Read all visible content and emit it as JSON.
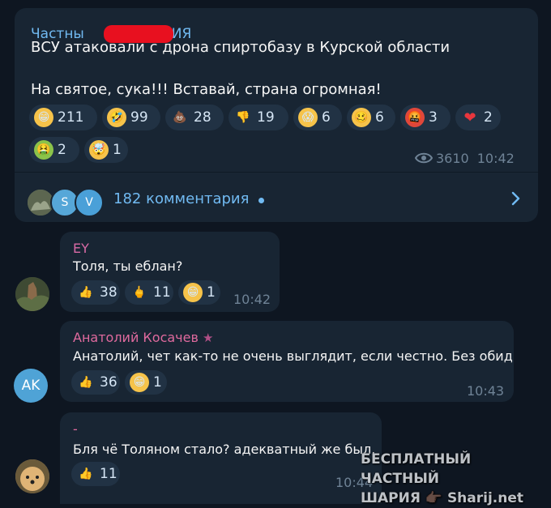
{
  "post": {
    "channel_visible": "Частны",
    "channel_tail": "АРИЯ",
    "line1": "ВСУ атаковали с дрона спиртобазу в Курской области",
    "line2": "На святое, сука!!! Вставай, страна огромная!",
    "reactions": [
      {
        "emoji": "😁",
        "count": "211",
        "icon": "grin-emoji",
        "bg": "#f6c34a"
      },
      {
        "emoji": "🤣",
        "count": "99",
        "icon": "rofl-emoji",
        "bg": "#f6c34a"
      },
      {
        "emoji": "💩",
        "count": "28",
        "icon": "poop-emoji",
        "bg": "transparent"
      },
      {
        "emoji": "👎",
        "count": "19",
        "icon": "thumbs-down-emoji",
        "bg": "transparent"
      },
      {
        "emoji": "😱",
        "count": "6",
        "icon": "scream-emoji",
        "bg": "#f6c34a"
      },
      {
        "emoji": "🥴",
        "count": "6",
        "icon": "woozy-emoji",
        "bg": "#f6c34a"
      },
      {
        "emoji": "🤬",
        "count": "3",
        "icon": "cursing-emoji",
        "bg": "#e0473a"
      },
      {
        "emoji": "❤",
        "count": "2",
        "icon": "heart-emoji",
        "bg": "transparent"
      },
      {
        "emoji": "🤮",
        "count": "2",
        "icon": "vomit-emoji",
        "bg": "#8bc34a"
      },
      {
        "emoji": "🤯",
        "count": "1",
        "icon": "exploding-head-emoji",
        "bg": "#f6c34a"
      }
    ],
    "views": "3610",
    "time": "10:42",
    "comments_label": "182 комментария",
    "commenter_avatars": [
      {
        "letter": "",
        "color": "#6b7a5a"
      },
      {
        "letter": "S",
        "color": "#56a7d8"
      },
      {
        "letter": "V",
        "color": "#4aa0d8"
      }
    ]
  },
  "comments": [
    {
      "name": "EY",
      "name_color": "#d96aa6",
      "text": "Толя, ты еблан?",
      "time": "10:42",
      "avatar_letters": "",
      "avatar_color": "#4a5a3e",
      "reactions": [
        {
          "emoji": "👍",
          "count": "38"
        },
        {
          "emoji": "🖕",
          "count": "11"
        },
        {
          "emoji": "😁",
          "count": "1"
        }
      ]
    },
    {
      "name": "Анатолий Косачев",
      "name_color": "#e06a9e",
      "text": "Анатолий, чет как-то не очень выглядит, если честно. Без обид",
      "time": "10:43",
      "avatar_letters": "AK",
      "avatar_color": "#4fa3d6",
      "reactions": [
        {
          "emoji": "👍",
          "count": "36"
        },
        {
          "emoji": "😁",
          "count": "1"
        }
      ]
    },
    {
      "name": "-",
      "name_color": "#e06a9e",
      "text": "Бля чё Толяном стало? адекватный же был.",
      "time": "10:44",
      "avatar_letters": "",
      "avatar_color": "#c9a06a",
      "reactions": [
        {
          "emoji": "👍",
          "count": "11"
        }
      ]
    }
  ],
  "watermark": {
    "line1": "БЕСПЛАТНЫЙ ЧАСТНЫЙ",
    "line2": "ШАРИЯ 👉🏿 Sharij.net"
  }
}
